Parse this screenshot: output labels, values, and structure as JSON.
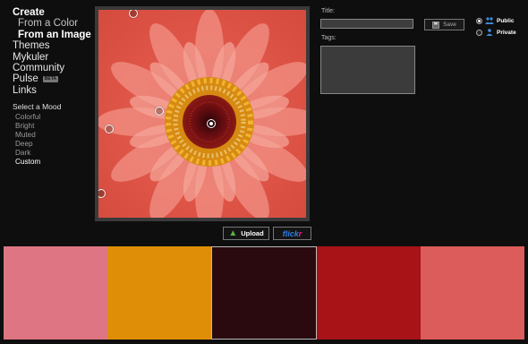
{
  "nav": {
    "create": "Create",
    "from_color": "From a Color",
    "from_image": "From an Image",
    "themes": "Themes",
    "mykuler": "Mykuler",
    "community": "Community",
    "pulse": "Pulse",
    "pulse_badge": "BETA",
    "links": "Links"
  },
  "mood": {
    "title": "Select a Mood",
    "items": [
      "Colorful",
      "Bright",
      "Muted",
      "Deep",
      "Dark",
      "Custom"
    ],
    "active": "Custom"
  },
  "image": {
    "upload_label": "Upload",
    "flickr_part1": "flick",
    "flickr_part2": "r"
  },
  "form": {
    "title_label": "Title:",
    "title_value": "",
    "tags_label": "Tags:",
    "tags_value": "",
    "save_label": "Save",
    "visibility": {
      "public_label": "Public",
      "private_label": "Private",
      "selected": "Public"
    }
  },
  "swatches": {
    "colors": [
      "#dd7582",
      "#df8f07",
      "#2a0a0e",
      "#a71317",
      "#dc5b5b"
    ],
    "selected_index": 2
  }
}
